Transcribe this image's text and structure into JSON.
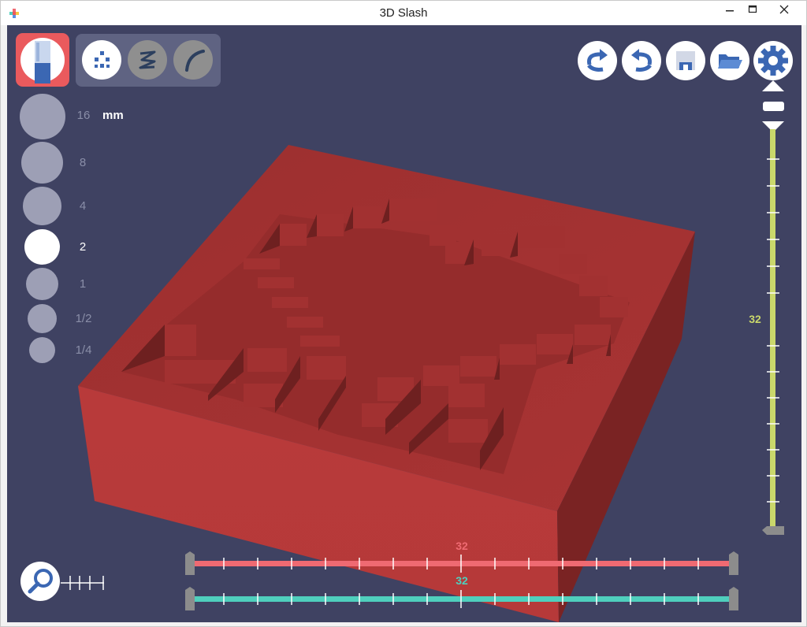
{
  "window": {
    "title": "3D Slash"
  },
  "brush_sizes": {
    "unit": "mm",
    "items": [
      {
        "label": "16",
        "active": false
      },
      {
        "label": "8",
        "active": false
      },
      {
        "label": "4",
        "active": false
      },
      {
        "label": "2",
        "active": true
      },
      {
        "label": "1",
        "active": false
      },
      {
        "label": "1/2",
        "active": false
      },
      {
        "label": "1/4",
        "active": false
      }
    ]
  },
  "tools": [
    {
      "name": "hammer",
      "icon": "hammer-icon",
      "active": true
    },
    {
      "name": "dots",
      "icon": "dots-pattern-icon",
      "active": false
    },
    {
      "name": "zigzag",
      "icon": "zigzag-icon",
      "active": false
    },
    {
      "name": "curve",
      "icon": "curve-icon",
      "active": false
    }
  ],
  "top_actions": [
    {
      "name": "redo",
      "icon": "redo-arrow-icon"
    },
    {
      "name": "undo",
      "icon": "undo-arrow-icon"
    },
    {
      "name": "save",
      "icon": "floppy-disk-icon"
    },
    {
      "name": "open",
      "icon": "folder-open-icon"
    },
    {
      "name": "settings",
      "icon": "gear-icon"
    }
  ],
  "sliders": {
    "vertical": {
      "value": "32",
      "color": "#cad86b"
    },
    "horizontal_top": {
      "value": "32",
      "color": "#ef6a72"
    },
    "horizontal_bottom": {
      "value": "32",
      "color": "#4fcfbd"
    }
  },
  "colors": {
    "background": "#3f4262",
    "model": "#b93a3a",
    "accent": "#ea5a5d"
  }
}
